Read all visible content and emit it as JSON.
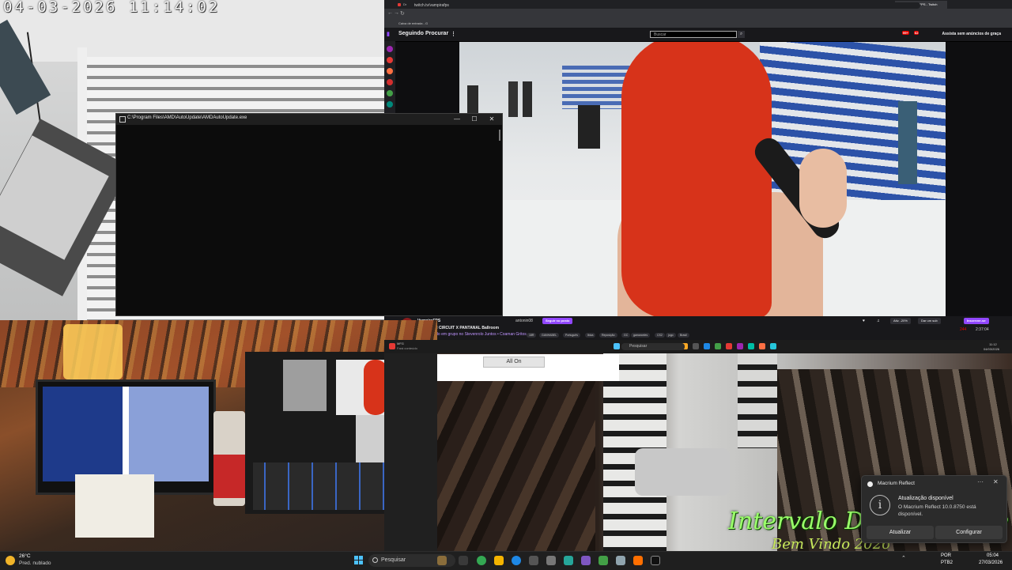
{
  "cctv": {
    "timestamp": "04-03-2026 11:14:02"
  },
  "cmd": {
    "title": "C:\\Program Files\\AMD\\AutoUpdate\\AMDAutoUpdate.exe",
    "minimize": "—",
    "maximize": "☐",
    "close": "✕"
  },
  "browser": {
    "tabs": [
      {
        "label": "Dream Grátis lo",
        "color": "#e53935"
      },
      {
        "label": "(20*) Lula anuncia impostos",
        "color": "#e53935"
      },
      {
        "label": "(508) Mack Maria, Tulla Knot",
        "color": "#e53935"
      },
      {
        "label": "(287) A VIRTUDE DA PRUDÊN",
        "color": "#e53935"
      },
      {
        "label": "O ttrzy casa rbd dell latitude",
        "color": "#e53935"
      },
      {
        "label": "Santi Reparo - Assistência Té",
        "color": "#1e88e5"
      },
      {
        "label": "Caixa de entrada (1978) - Emi",
        "color": "#1e88e5"
      },
      {
        "label": "Rattrapper (National Beck - ti",
        "color": "#e53935"
      },
      {
        "label": "(522) PARVISION e MORTE",
        "color": "#e53935"
      },
      {
        "label": "(62) VampiraFPS - Twitch",
        "color": "#9147ff"
      }
    ],
    "promo": "Reiniciar para atualizar",
    "url": "twitch.tv/vampirafps",
    "bookmark": "Caixa de entrada - G",
    "twitch": {
      "nav_following": "Seguindo",
      "nav_browse": "Procurar",
      "search_placeholder": "Buscar",
      "badge1": "99+",
      "badge2": "62",
      "turbo": "Assista sem anúncios de graça"
    },
    "channel": {
      "name": "VampiraFPS",
      "title": "BETBOOM CIRCUIT X PANTANAL Ballroom",
      "subtitle": "Transmitindo em grupo no Stevenrolo Juntos • Coaman Gritos",
      "live": "AO VIVO",
      "follow": "Seguir no posto",
      "user": "antonin08",
      "tags": [
        "18R",
        "GANHABEL",
        "Português",
        "Ibiza",
        "Reposição",
        "GC",
        "gamarceles",
        "CS2",
        "jogo",
        "Brasil"
      ],
      "viewers": "244",
      "uptime": "2:37:04",
      "subscribe": "Inscrever-se",
      "gift": "Dar um sub",
      "subs_label": "Ativ. -20%"
    }
  },
  "remote": {
    "tray_time": "11:12",
    "tray_date": "04/03/2026",
    "search": "Pesquisar",
    "user": "MFG",
    "mode": "Fará conteúdo",
    "all_on": "All On",
    "overlay_line1": "Intervalo De Felicidade",
    "overlay_line2": "Bem Vindo 2026"
  },
  "notification": {
    "app": "Macrium Reflect",
    "title": "Atualização disponível",
    "body": "O Macrium Reflect 10.0.8750 está disponível.",
    "btn_update": "Atualizar",
    "btn_settings": "Configurar",
    "more": "···",
    "close": "✕"
  },
  "taskbar": {
    "temperature": "26°C",
    "condition": "Pred. nublado",
    "search": "Pesquisar",
    "tray_arrow": "⌃",
    "lang": "POR",
    "lang2": "PTB2",
    "time": "05:04",
    "date": "27/03/2026"
  }
}
